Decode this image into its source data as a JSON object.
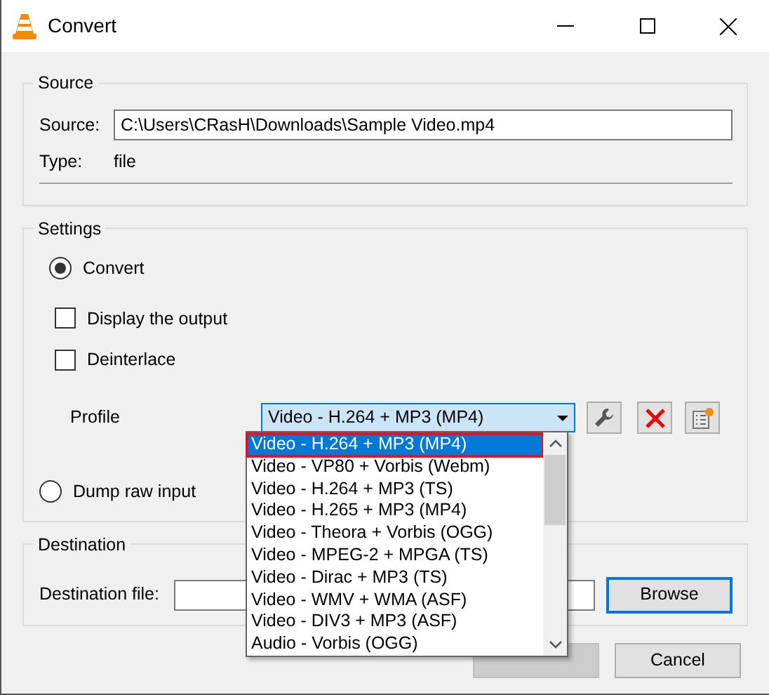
{
  "window": {
    "title": "Convert"
  },
  "source": {
    "legend": "Source",
    "source_label": "Source:",
    "source_value": "C:\\Users\\CRasH\\Downloads\\Sample Video.mp4",
    "type_label": "Type:",
    "type_value": "file"
  },
  "settings": {
    "legend": "Settings",
    "convert_option": {
      "label": "Convert",
      "selected": true
    },
    "checkboxes": [
      {
        "label": "Display the output",
        "checked": false
      },
      {
        "label": "Deinterlace",
        "checked": false
      }
    ],
    "profile": {
      "label": "Profile",
      "value": "Video - H.264 + MP3 (MP4)",
      "expanded": true,
      "options": [
        {
          "label": "Video - H.264 + MP3 (MP4)",
          "selected": true,
          "annotated": true
        },
        {
          "label": "Video - VP80 + Vorbis (Webm)",
          "selected": false,
          "annotated": false
        },
        {
          "label": "Video - H.264 + MP3 (TS)",
          "selected": false,
          "annotated": false
        },
        {
          "label": "Video - H.265 + MP3 (MP4)",
          "selected": false,
          "annotated": false
        },
        {
          "label": "Video - Theora + Vorbis (OGG)",
          "selected": false,
          "annotated": false
        },
        {
          "label": "Video - MPEG-2 + MPGA (TS)",
          "selected": false,
          "annotated": false
        },
        {
          "label": "Video - Dirac + MP3 (TS)",
          "selected": false,
          "annotated": false
        },
        {
          "label": "Video - WMV + WMA (ASF)",
          "selected": false,
          "annotated": false
        },
        {
          "label": "Video - DIV3 + MP3 (ASF)",
          "selected": false,
          "annotated": false
        },
        {
          "label": "Audio - Vorbis (OGG)",
          "selected": false,
          "annotated": false
        }
      ]
    },
    "dump_option": {
      "label": "Dump raw input",
      "selected": false
    }
  },
  "destination": {
    "legend": "Destination",
    "file_label": "Destination file:",
    "browse": "Browse"
  },
  "buttons": [
    {
      "disabled": true
    },
    {
      "label": "Cancel",
      "disabled": false
    }
  ]
}
